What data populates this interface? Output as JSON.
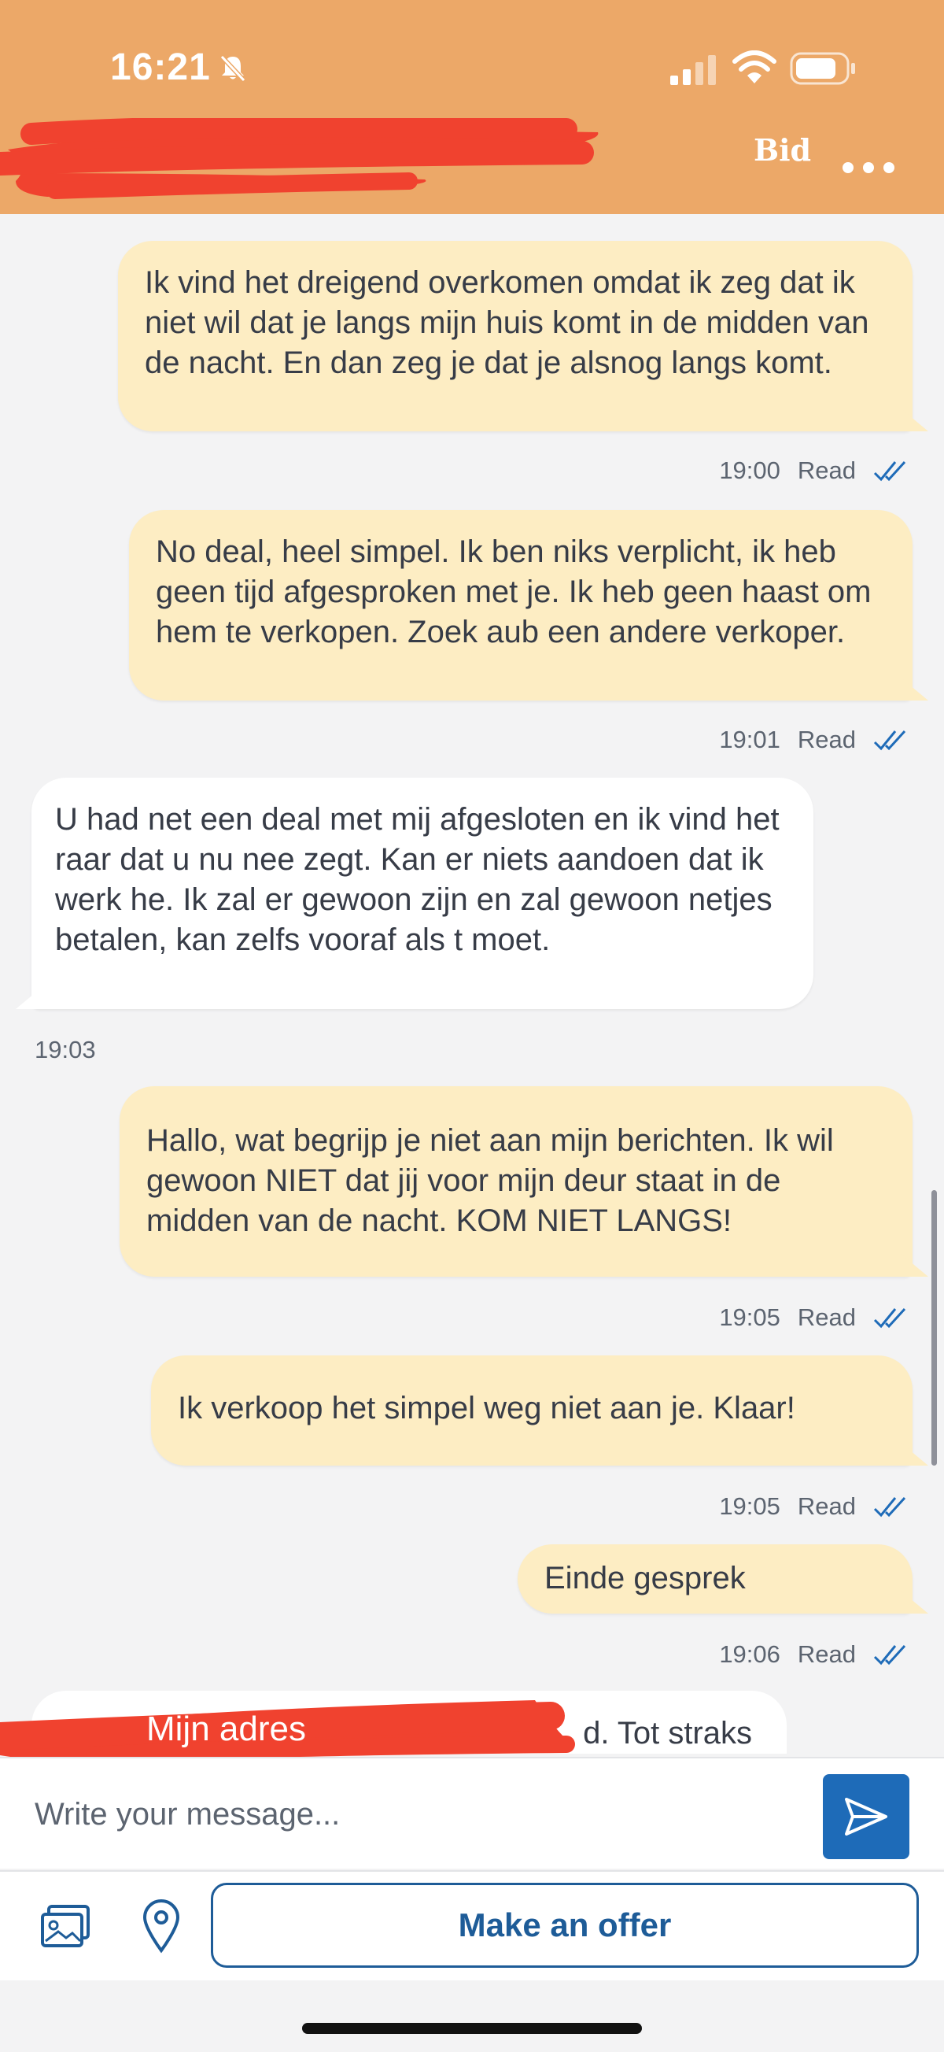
{
  "status_bar": {
    "time": "16:21"
  },
  "header": {
    "bid_label": "Bid",
    "more_icon": "more-dots-icon",
    "background_color": "#eca868"
  },
  "messages": [
    {
      "sender": "me",
      "text": "Ik vind het dreigend overkomen omdat ik zeg dat ik niet wil dat je langs mijn huis komt in de midden van de nacht. En dan zeg je dat je alsnog langs komt.",
      "time": "19:00",
      "status": "Read"
    },
    {
      "sender": "me",
      "text": "No deal, heel simpel. Ik ben niks verplicht, ik heb geen tijd afgesproken met je. Ik heb geen haast om hem te verkopen. Zoek aub een andere verkoper.",
      "time": "19:01",
      "status": "Read"
    },
    {
      "sender": "them",
      "text": "U had net een deal met mij afgesloten en ik vind het raar dat u nu nee zegt. Kan er niets aandoen dat ik werk he. Ik zal er gewoon zijn en zal gewoon netjes betalen, kan zelfs vooraf als t moet.",
      "time": "19:03"
    },
    {
      "sender": "me",
      "text": "Hallo, wat begrijp je niet aan mijn berichten. Ik wil gewoon NIET dat jij voor mijn deur staat in de midden van de nacht. KOM NIET LANGS!",
      "time": "19:05",
      "status": "Read"
    },
    {
      "sender": "me",
      "text": "Ik verkoop het simpel weg niet aan je. Klaar!",
      "time": "19:05",
      "status": "Read"
    },
    {
      "sender": "me",
      "text": "Einde gesprek",
      "time": "19:06",
      "status": "Read"
    },
    {
      "sender": "them",
      "partial_text": "d. Tot straks",
      "redaction_label": "Mijn adres"
    }
  ],
  "composer": {
    "placeholder": "Write your message...",
    "send_icon": "send-icon"
  },
  "actions": {
    "photo_icon": "photo-gallery-icon",
    "location_icon": "location-pin-icon",
    "offer_label": "Make an offer"
  },
  "colors": {
    "my_bubble": "#fdedc3",
    "their_bubble": "#ffffff",
    "accent": "#1e6bb8",
    "redaction": "#f0422f"
  }
}
